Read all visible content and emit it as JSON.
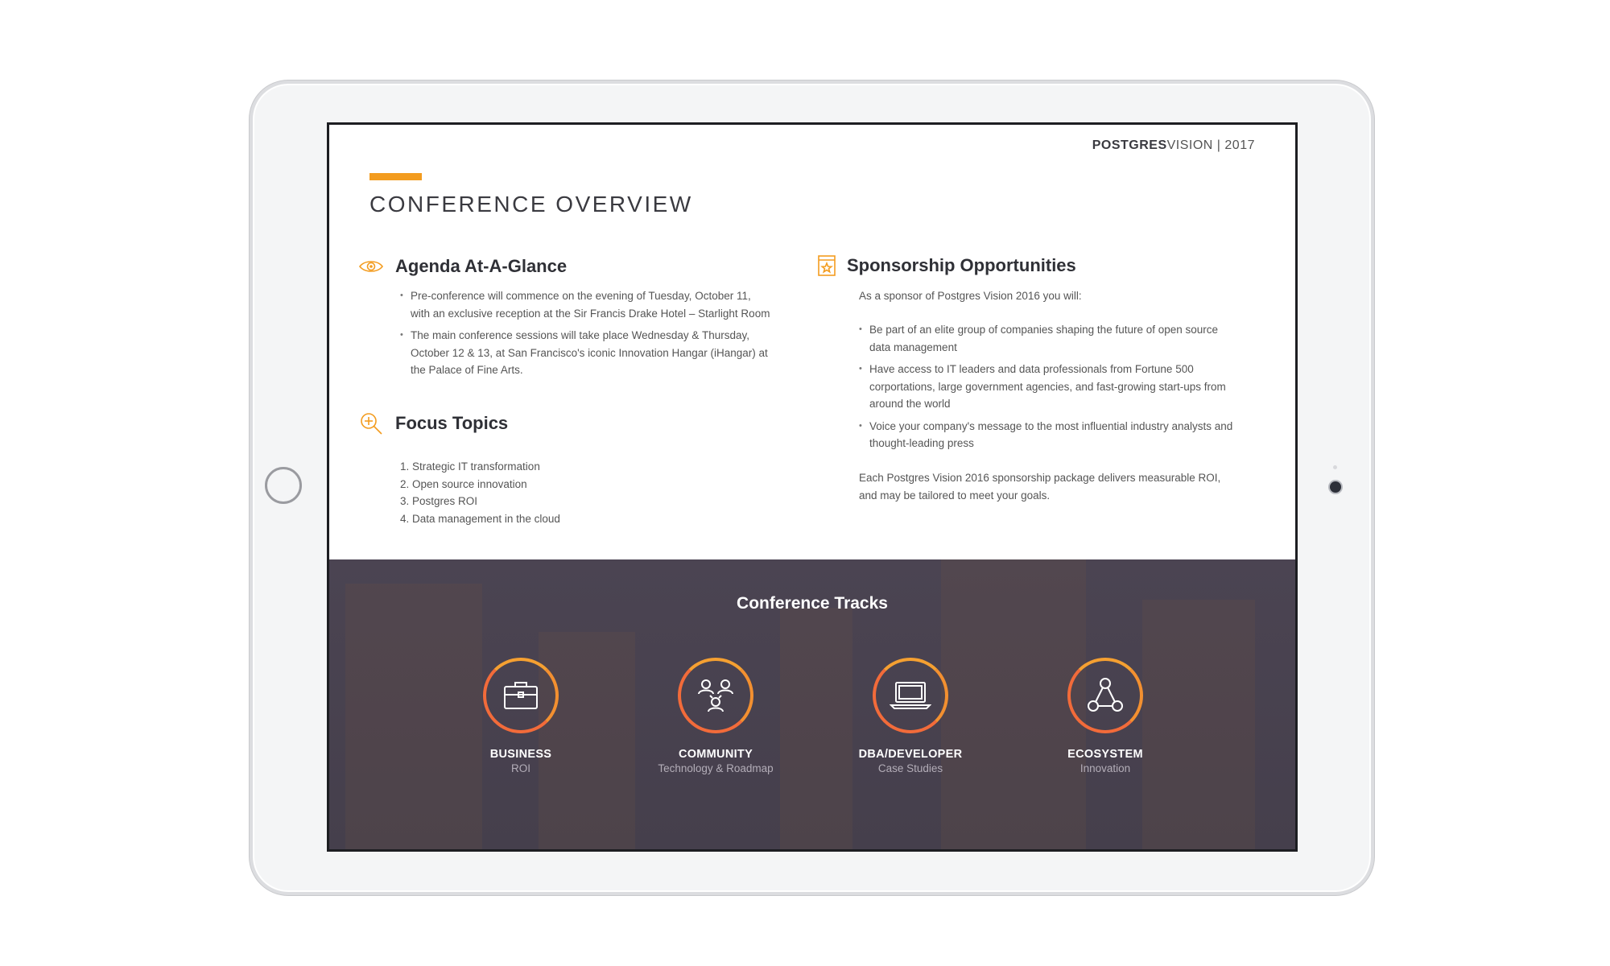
{
  "brand": {
    "bold": "POSTGRES",
    "light": "VISION | 2017"
  },
  "page_title": "CONFERENCE OVERVIEW",
  "agenda": {
    "title": "Agenda At-A-Glance",
    "icon": "eye-icon",
    "items": [
      "Pre-conference will commence on the evening of Tuesday, October 11, with an exclusive reception at the Sir Francis Drake Hotel – Starlight Room",
      "The main conference sessions will take place Wednesday & Thursday, October 12 & 13, at San Francisco's iconic Innovation Hangar (iHangar) at the Palace of Fine Arts."
    ]
  },
  "focus": {
    "title": "Focus Topics",
    "icon": "magnifier-plus-icon",
    "items": [
      "1.  Strategic IT transformation",
      "2.  Open source innovation",
      "3.  Postgres ROI",
      "4.   Data management in the cloud"
    ]
  },
  "sponsorship": {
    "title": "Sponsorship Opportunities",
    "icon": "certificate-star-icon",
    "intro": "As a sponsor of Postgres Vision 2016 you will:",
    "items": [
      "Be part of an elite group of companies shaping the future of open source data management",
      "Have access to IT leaders and data professionals from Fortune 500 corportations, large government agencies, and fast-growing start-ups from around the world",
      "Voice your company's message to the most influential industry analysts and thought-leading press"
    ],
    "closing": "Each Postgres Vision 2016 sponsorship package delivers measurable ROI, and may be tailored to meet your goals."
  },
  "tracks": {
    "title": "Conference Tracks",
    "items": [
      {
        "name": "BUSINESS",
        "sub": "ROI",
        "icon": "briefcase-icon"
      },
      {
        "name": "COMMUNITY",
        "sub": "Technology & Roadmap",
        "icon": "people-network-icon"
      },
      {
        "name": "DBA/DEVELOPER",
        "sub": "Case Studies",
        "icon": "laptop-icon"
      },
      {
        "name": "ECOSYSTEM",
        "sub": "Innovation",
        "icon": "nodes-icon"
      }
    ]
  },
  "colors": {
    "accent": "#f39c1f",
    "ring": "#f26b3a",
    "band": "#4b4452"
  }
}
